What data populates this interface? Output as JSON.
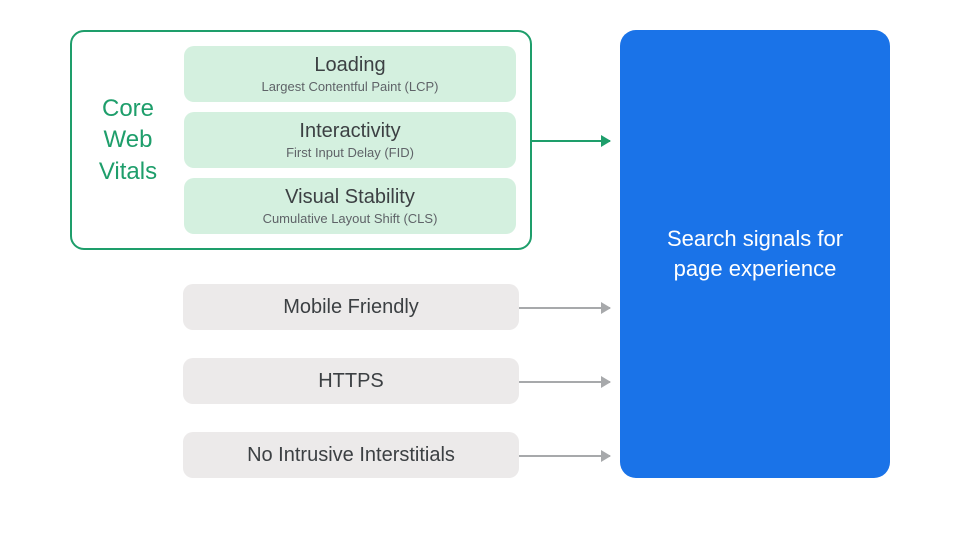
{
  "cwv": {
    "label": "Core\nWeb\nVitals",
    "items": [
      {
        "title": "Loading",
        "sub": "Largest Contentful Paint (LCP)"
      },
      {
        "title": "Interactivity",
        "sub": "First Input Delay (FID)"
      },
      {
        "title": "Visual Stability",
        "sub": "Cumulative Layout Shift (CLS)"
      }
    ]
  },
  "signals": [
    "Mobile Friendly",
    "HTTPS",
    "No Intrusive Interstitials"
  ],
  "output": "Search signals for page experience",
  "colors": {
    "green": "#1e9e6b",
    "green_fill": "#d4f0df",
    "gray_fill": "#eceaea",
    "blue": "#1a73e8",
    "arrow_gray": "#a7a9ab"
  }
}
